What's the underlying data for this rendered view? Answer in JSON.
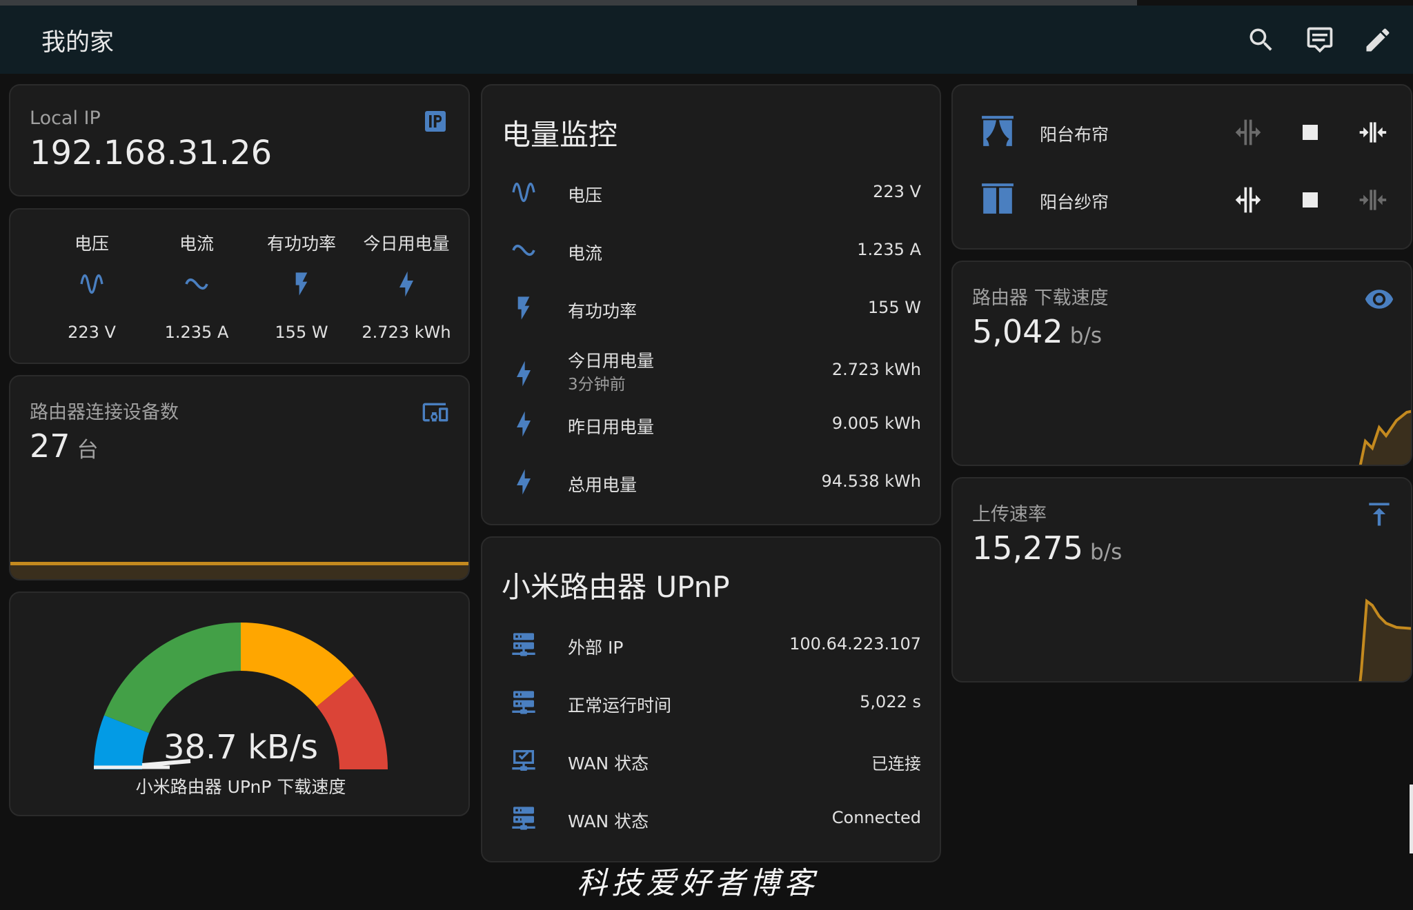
{
  "header": {
    "title": "我的家",
    "buttons": [
      "search-icon",
      "assist-icon",
      "edit-icon"
    ]
  },
  "local_ip": {
    "name": "Local IP",
    "value": "192.168.31.26",
    "icon": "ip-network-icon"
  },
  "glance": {
    "items": [
      {
        "name": "电压",
        "value": "223 V",
        "icon": "sine-wave-icon"
      },
      {
        "name": "电流",
        "value": "1.235 A",
        "icon": "current-ac-icon"
      },
      {
        "name": "有功功率",
        "value": "155 W",
        "icon": "flash-icon"
      },
      {
        "name": "今日用电量",
        "value": "2.723 kWh",
        "icon": "lightning-bolt-icon"
      }
    ]
  },
  "router_devices": {
    "name": "路由器连接设备数",
    "value": "27",
    "unit": "台",
    "icon": "devices-icon"
  },
  "gauge": {
    "value": "38.7 kB/s",
    "name": "小米路由器 UPnP 下载速度",
    "level": 0.04,
    "colors": [
      "#039be5",
      "#43a047",
      "#ffa600",
      "#db4437"
    ]
  },
  "power": {
    "title": "电量监控",
    "rows": [
      {
        "name": "电压",
        "value": "223 V",
        "icon": "sine-wave-icon"
      },
      {
        "name": "电流",
        "value": "1.235 A",
        "icon": "current-ac-icon"
      },
      {
        "name": "有功功率",
        "value": "155 W",
        "icon": "flash-icon"
      },
      {
        "name": "今日用电量",
        "secondary": "3分钟前",
        "value": "2.723 kWh",
        "icon": "lightning-bolt-icon"
      },
      {
        "name": "昨日用电量",
        "value": "9.005 kWh",
        "icon": "lightning-bolt-icon"
      },
      {
        "name": "总用电量",
        "value": "94.538 kWh",
        "icon": "lightning-bolt-icon"
      }
    ]
  },
  "upnp": {
    "title": "小米路由器 UPnP",
    "rows": [
      {
        "name": "外部 IP",
        "value": "100.64.223.107",
        "icon": "server-network-icon"
      },
      {
        "name": "正常运行时间",
        "value": "5,022 s",
        "icon": "server-network-icon"
      },
      {
        "name": "WAN 状态",
        "value": "已连接",
        "icon": "check-network-icon"
      },
      {
        "name": "WAN 状态",
        "value": "Connected",
        "icon": "server-network-icon"
      }
    ]
  },
  "curtains": [
    {
      "name": "阳台布帘",
      "icon": "curtains-open-icon"
    },
    {
      "name": "阳台纱帘",
      "icon": "curtains-closed-icon"
    }
  ],
  "download": {
    "name": "路由器 下载速度",
    "value": "5,042",
    "unit": "b/s",
    "icon": "eye-icon"
  },
  "upload": {
    "name": "上传速率",
    "value": "15,275",
    "unit": "b/s",
    "icon": "upload-arrow-icon"
  },
  "watermark": "科技爱好者博客",
  "colors": {
    "accent": "#4a7fc0",
    "graph": "#c48a1f"
  }
}
